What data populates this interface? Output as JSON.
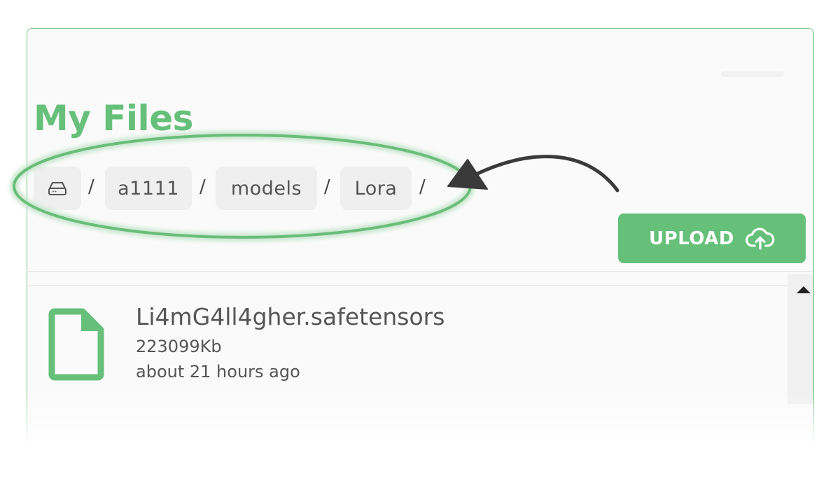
{
  "page": {
    "title": "My Files"
  },
  "breadcrumb": {
    "root_icon": "drive-icon",
    "separator": "/",
    "items": [
      {
        "label": "a1111"
      },
      {
        "label": "models"
      },
      {
        "label": "Lora"
      }
    ]
  },
  "toolbar": {
    "upload_label": "UPLOAD",
    "upload_icon": "cloud-upload-icon"
  },
  "files": [
    {
      "name": "Li4mG4ll4gher.safetensors",
      "size": "223099Kb",
      "modified": "about 21 hours ago",
      "icon": "file-icon"
    }
  ],
  "colors": {
    "accent": "#66c07a",
    "annotation_ring": "#6abd79",
    "annotation_arrow": "#3a3a3a"
  }
}
